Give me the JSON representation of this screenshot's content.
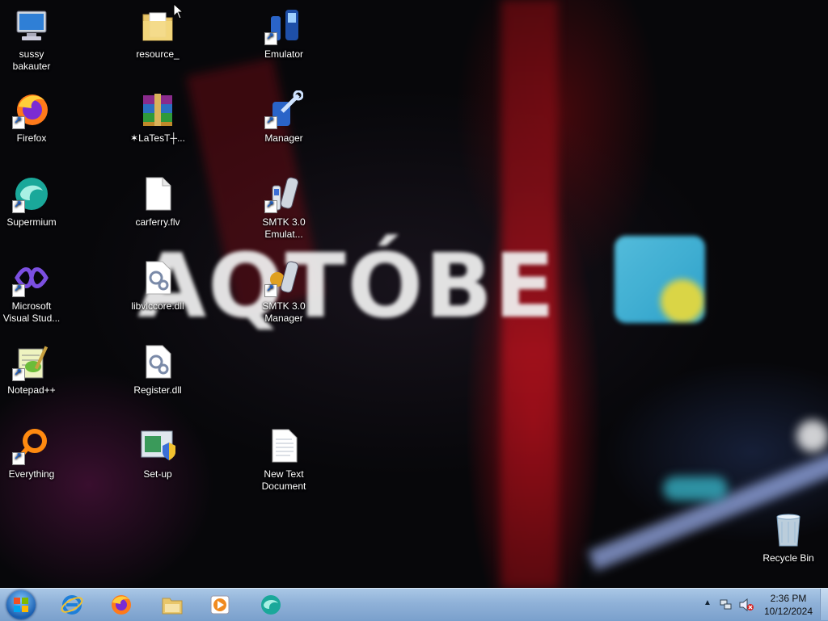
{
  "desktop": {
    "icons": [
      {
        "label": "sussy bakauter",
        "icon": "computer-icon"
      },
      {
        "label": "Firefox",
        "icon": "firefox-icon"
      },
      {
        "label": "Supermium",
        "icon": "supermium-icon"
      },
      {
        "label": "Microsoft Visual Stud...",
        "icon": "visual-studio-icon"
      },
      {
        "label": "Notepad++",
        "icon": "notepadpp-icon"
      },
      {
        "label": "Everything",
        "icon": "everything-icon"
      },
      {
        "label": "resource_",
        "icon": "folder-icon"
      },
      {
        "label": "✶LaTesT┼...",
        "icon": "winrar-icon"
      },
      {
        "label": "carferry.flv",
        "icon": "file-icon"
      },
      {
        "label": "libvlccore.dll",
        "icon": "dll-icon"
      },
      {
        "label": "Register.dll",
        "icon": "dll-icon"
      },
      {
        "label": "Set-up",
        "icon": "setup-icon"
      },
      {
        "label": "Emulator",
        "icon": "emulator-icon"
      },
      {
        "label": "Manager",
        "icon": "manager-icon"
      },
      {
        "label": "SMTK 3.0 Emulat...",
        "icon": "smtk-emulator-icon"
      },
      {
        "label": "SMTK 3.0 Manager",
        "icon": "smtk-manager-icon"
      },
      {
        "label": "New Text Document",
        "icon": "text-document-icon"
      },
      {
        "label": "Recycle Bin",
        "icon": "recycle-bin-icon"
      }
    ]
  },
  "wallpaper": {
    "wordmark": "AQTÓBE"
  },
  "taskbar": {
    "pinned": [
      "start-orb",
      "internet-explorer-icon",
      "firefox-icon",
      "file-explorer-icon",
      "media-player-icon",
      "supermium-icon"
    ],
    "clock": {
      "time": "2:36 PM",
      "date": "10/12/2024"
    }
  },
  "colors": {
    "taskbar": "#8fb1d8",
    "desktop_bg": "#07070a"
  }
}
